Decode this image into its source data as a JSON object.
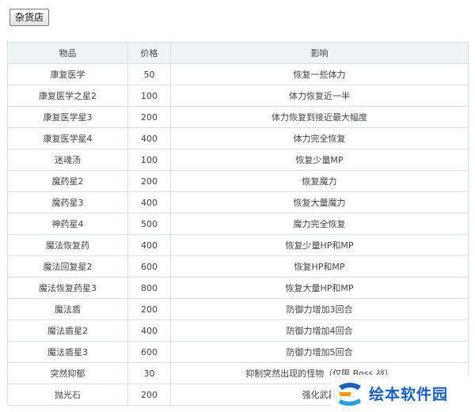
{
  "shop_button": {
    "label": "杂货店"
  },
  "table": {
    "headers": [
      "物品",
      "价格",
      "影响"
    ],
    "rows": [
      {
        "item": "康复医学",
        "price": "50",
        "effect": "恢复一些体力"
      },
      {
        "item": "康复医学之星2",
        "price": "100",
        "effect": "体力恢复近一半"
      },
      {
        "item": "康复医学星3",
        "price": "200",
        "effect": "体力恢复到接近最大幅度"
      },
      {
        "item": "康复医学星4",
        "price": "400",
        "effect": "体力完全恢复"
      },
      {
        "item": "迷魂汤",
        "price": "100",
        "effect": "恢复少量MP"
      },
      {
        "item": "魔药星2",
        "price": "200",
        "effect": "恢复魔力"
      },
      {
        "item": "魔药星3",
        "price": "400",
        "effect": "恢复大量魔力"
      },
      {
        "item": "神药星4",
        "price": "500",
        "effect": "魔力完全恢复"
      },
      {
        "item": "魔法恢复药",
        "price": "400",
        "effect": "恢复少量HP和MP"
      },
      {
        "item": "魔法回复星2",
        "price": "600",
        "effect": "恢复HP和MP"
      },
      {
        "item": "魔法恢复药星3",
        "price": "800",
        "effect": "恢复大量HP和MP"
      },
      {
        "item": "魔法盾",
        "price": "200",
        "effect": "防御力增加3回合"
      },
      {
        "item": "魔法盾星2",
        "price": "400",
        "effect": "防御力增加4回合"
      },
      {
        "item": "魔法盾星3",
        "price": "600",
        "effect": "防御力增加5回合"
      },
      {
        "item": "突然抑郁",
        "price": "30",
        "effect": "抑制突然出现的怪物（仅限 Boss 战）"
      },
      {
        "item": "抛光石",
        "price": "200",
        "effect": "强化武器"
      }
    ]
  },
  "watermark": {
    "text": "绘本软件园",
    "colors": [
      "#1f5fb5",
      "#f39800",
      "#2a9fd8"
    ]
  }
}
